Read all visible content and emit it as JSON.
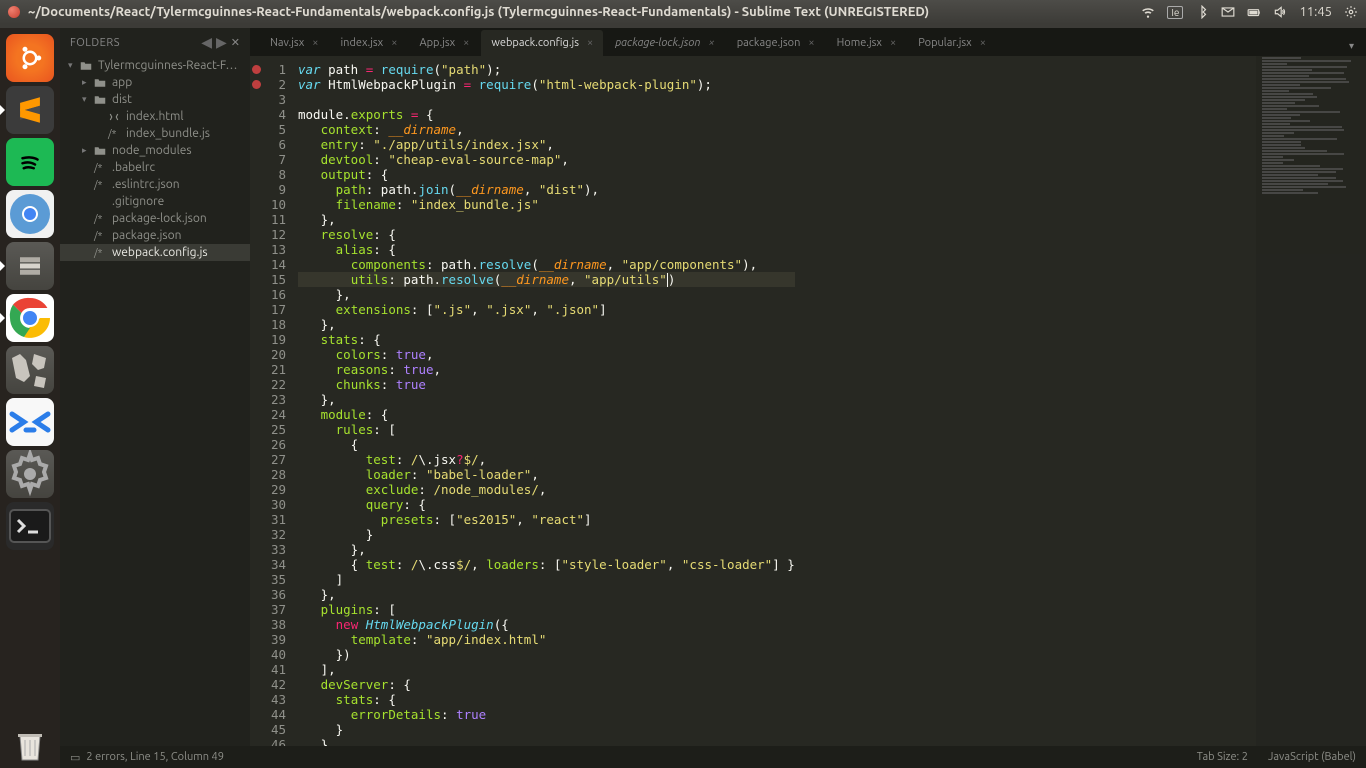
{
  "titlebar": {
    "title": "~/Documents/React/Tylermcguinnes-React-Fundamentals/webpack.config.js (Tylermcguinnes-React-Fundamentals) - Sublime Text (UNREGISTERED)",
    "clock": "11:45",
    "lang": "Ie"
  },
  "sidebar": {
    "title": "FOLDERS",
    "tree": [
      {
        "depth": 0,
        "disclosure": "▾",
        "type": "folder",
        "label": "Tylermcguinnes-React-F…"
      },
      {
        "depth": 1,
        "disclosure": "▸",
        "type": "folder",
        "label": "app"
      },
      {
        "depth": 1,
        "disclosure": "▾",
        "type": "folder",
        "label": "dist"
      },
      {
        "depth": 2,
        "disclosure": "",
        "type": "html",
        "label": "index.html"
      },
      {
        "depth": 2,
        "disclosure": "",
        "type": "js",
        "label": "index_bundle.js"
      },
      {
        "depth": 1,
        "disclosure": "▸",
        "type": "folder",
        "label": "node_modules"
      },
      {
        "depth": 1,
        "disclosure": "",
        "type": "js",
        "label": ".babelrc"
      },
      {
        "depth": 1,
        "disclosure": "",
        "type": "js",
        "label": ".eslintrc.json"
      },
      {
        "depth": 1,
        "disclosure": "",
        "type": "file",
        "label": ".gitignore"
      },
      {
        "depth": 1,
        "disclosure": "",
        "type": "js",
        "label": "package-lock.json"
      },
      {
        "depth": 1,
        "disclosure": "",
        "type": "js",
        "label": "package.json"
      },
      {
        "depth": 1,
        "disclosure": "",
        "type": "js",
        "label": "webpack.config.js",
        "selected": true
      }
    ]
  },
  "tabs": [
    {
      "label": "Nav.jsx",
      "active": false
    },
    {
      "label": "index.jsx",
      "active": false
    },
    {
      "label": "App.jsx",
      "active": false
    },
    {
      "label": "webpack.config.js",
      "active": true
    },
    {
      "label": "package-lock.json",
      "active": false,
      "italic": true
    },
    {
      "label": "package.json",
      "active": false
    },
    {
      "label": "Home.jsx",
      "active": false
    },
    {
      "label": "Popular.jsx",
      "active": false
    }
  ],
  "code": {
    "lines": 46,
    "marked": [
      1,
      2
    ],
    "current": 15
  },
  "statusbar": {
    "errors": "2 errors, Line 15, Column 49",
    "tabsize": "Tab Size: 2",
    "syntax": "JavaScript (Babel)"
  }
}
